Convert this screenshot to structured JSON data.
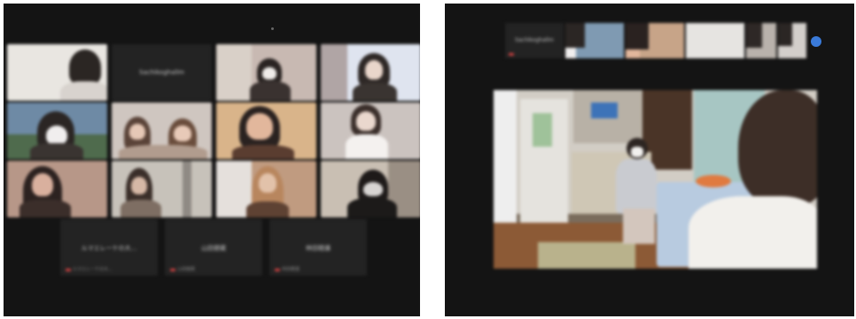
{
  "left_gallery": {
    "name_tiles": [
      "Sachikoghallm",
      "ルマエレーケの大...",
      "山田健蔵",
      "林田聰護"
    ],
    "mini_names": [
      "Sachikoghallm",
      "ルマエレーケの大...",
      "山田健蔵",
      "林田聰護"
    ]
  },
  "right_view": {
    "speaker_name": "Sachikoghallm",
    "thumb_count_label": ""
  },
  "colors": {
    "panel_bg": "#141414",
    "tile_bg": "#232323",
    "accent_blue": "#3a7ad9",
    "mute_red": "#d04040"
  }
}
